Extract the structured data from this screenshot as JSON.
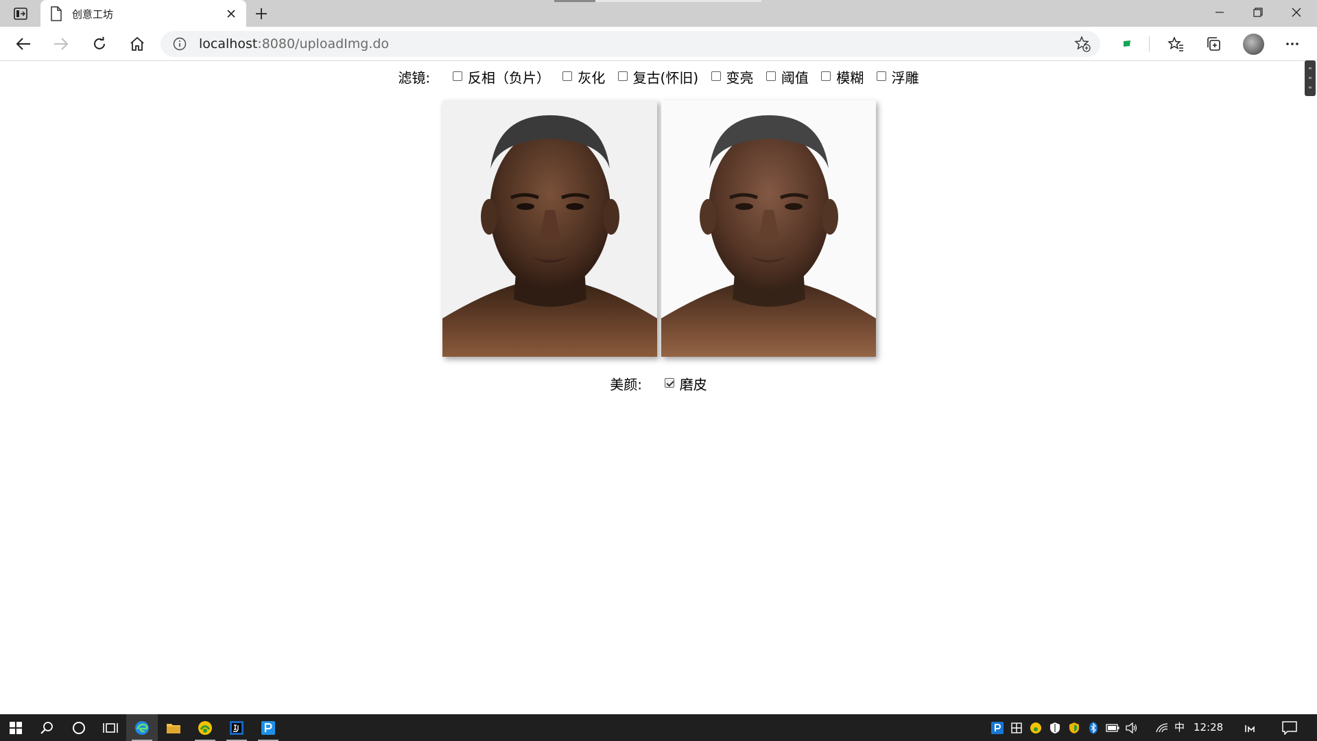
{
  "browser": {
    "tab_title": "创意工坊",
    "url_host": "localhost",
    "url_path": ":8080/uploadImg.do"
  },
  "page": {
    "filters": {
      "label": "滤镜:",
      "options": [
        {
          "label": "反相（负片）",
          "checked": false
        },
        {
          "label": "灰化",
          "checked": false
        },
        {
          "label": "复古(怀旧)",
          "checked": false
        },
        {
          "label": "变亮",
          "checked": false
        },
        {
          "label": "阈值",
          "checked": false
        },
        {
          "label": "模糊",
          "checked": false
        },
        {
          "label": "浮雕",
          "checked": false
        }
      ]
    },
    "images": [
      {
        "role": "original"
      },
      {
        "role": "processed"
      }
    ],
    "beauty": {
      "label": "美颜:",
      "options": [
        {
          "label": "磨皮",
          "checked": true
        }
      ]
    }
  },
  "taskbar": {
    "ime": "中",
    "time": "12:28"
  },
  "colors": {
    "tabstrip": "#cfcfcf",
    "taskbar": "#1f1f1f",
    "edge_blue": "#1e88e5",
    "tray_blue": "#1976d2"
  }
}
